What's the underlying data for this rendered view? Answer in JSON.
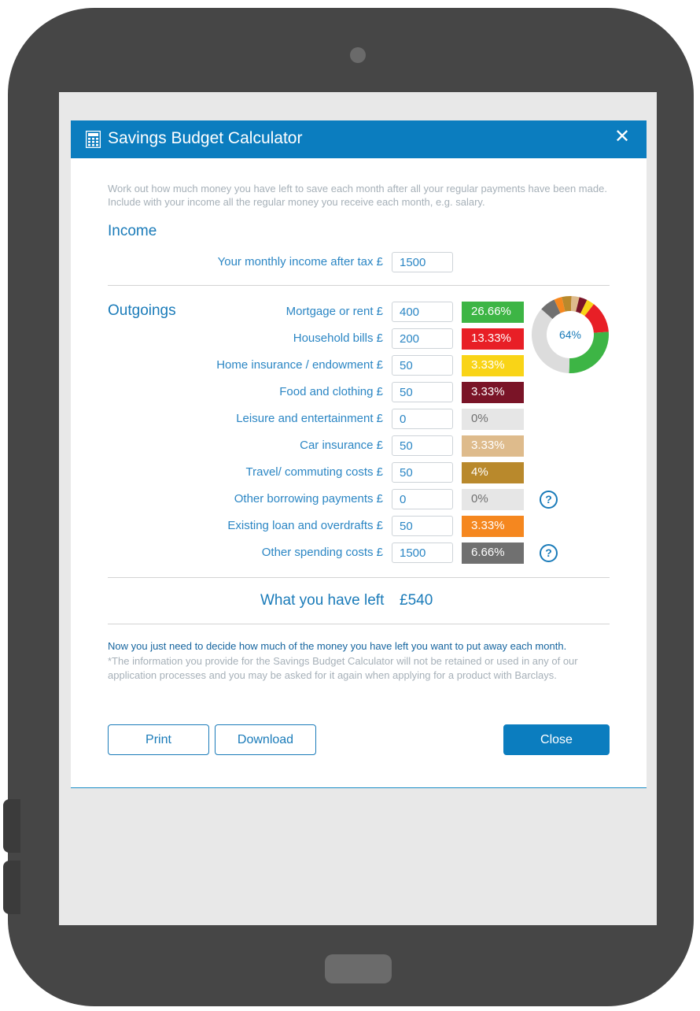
{
  "header": {
    "title": "Savings Budget Calculator",
    "close_symbol": "✕"
  },
  "intro": {
    "line1": "Work out how much money you have left to save each month after all your regular payments have been made.",
    "line2": "Include with your income all the regular money you receive each month, e.g. salary."
  },
  "income": {
    "title": "Income",
    "label": "Your monthly income after tax £",
    "value": "1500"
  },
  "outgoings": {
    "title": "Outgoings",
    "items": [
      {
        "label": "Mortgage or rent £",
        "value": "400",
        "percent": "26.66%",
        "color": "#3db545"
      },
      {
        "label": "Household bills £",
        "value": "200",
        "percent": "13.33%",
        "color": "#e81f26"
      },
      {
        "label": "Home insurance / endowment £",
        "value": "50",
        "percent": "3.33%",
        "color": "#f9d417"
      },
      {
        "label": "Food and clothing £",
        "value": "50",
        "percent": "3.33%",
        "color": "#7a1427"
      },
      {
        "label": "Leisure and entertainment £",
        "value": "0",
        "percent": "0%",
        "color": "#e6e6e6"
      },
      {
        "label": "Car insurance £",
        "value": "50",
        "percent": "3.33%",
        "color": "#debb8c"
      },
      {
        "label": "Travel/ commuting costs £",
        "value": "50",
        "percent": "4%",
        "color": "#b9892c"
      },
      {
        "label": "Other borrowing payments £",
        "value": "0",
        "percent": "0%",
        "color": "#e6e6e6",
        "help": "?"
      },
      {
        "label": "Existing loan and overdrafts £",
        "value": "50",
        "percent": "3.33%",
        "color": "#f5871f"
      },
      {
        "label": "Other spending costs £",
        "value": "1500",
        "percent": "6.66%",
        "color": "#707070",
        "help": "?"
      }
    ]
  },
  "donut": {
    "center_label": "64%",
    "remainder_color": "#dcdcdc",
    "segments": [
      {
        "name": "Mortgage or rent",
        "value": 26.66,
        "color": "#3db545"
      },
      {
        "name": "Household bills",
        "value": 13.33,
        "color": "#e81f26"
      },
      {
        "name": "Home insurance / endowment",
        "value": 3.33,
        "color": "#f9d417"
      },
      {
        "name": "Food and clothing",
        "value": 3.33,
        "color": "#7a1427"
      },
      {
        "name": "Car insurance",
        "value": 3.33,
        "color": "#debb8c"
      },
      {
        "name": "Travel/ commuting costs",
        "value": 4,
        "color": "#b9892c"
      },
      {
        "name": "Existing loan and overdrafts",
        "value": 3.33,
        "color": "#f5871f"
      },
      {
        "name": "Other spending costs",
        "value": 6.66,
        "color": "#707070"
      }
    ]
  },
  "result": {
    "label": "What you have left",
    "value": "£540"
  },
  "notes": {
    "main": "Now you just need to decide how much of the money you have left you want to put away each month.",
    "disclaimer1": "*The information you provide for the Savings Budget Calculator will not be retained or used in any of our",
    "disclaimer2": "application processes and you may be asked for it again when applying for a product with Barclays."
  },
  "buttons": {
    "print": "Print",
    "download": "Download",
    "close": "Close"
  }
}
